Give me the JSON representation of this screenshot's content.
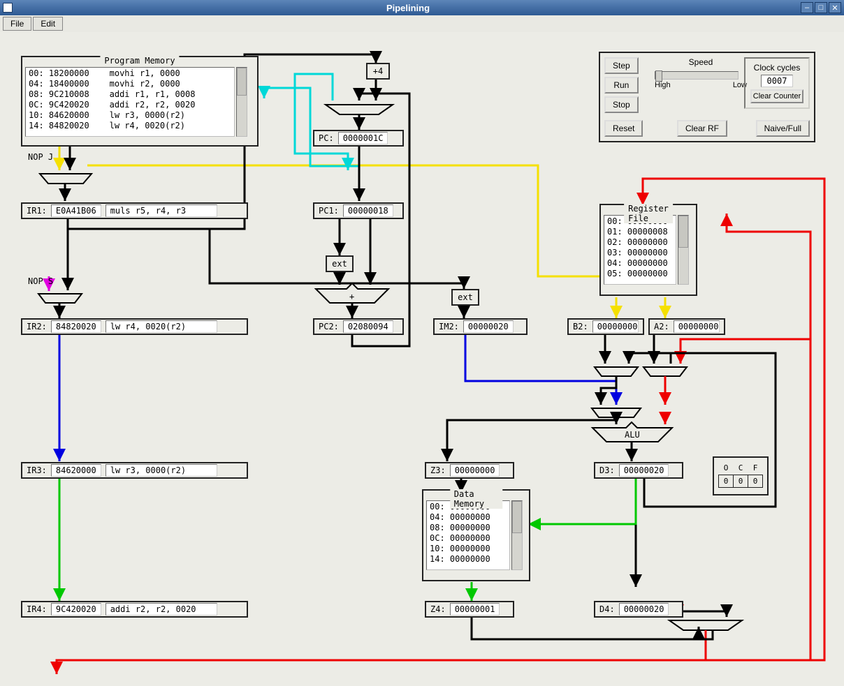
{
  "window": {
    "title": "Pipelining"
  },
  "menu": {
    "file": "File",
    "edit": "Edit"
  },
  "program_memory": {
    "caption": "Program Memory",
    "rows": [
      {
        "addr": "00:",
        "hex": "18200000",
        "asm": "movhi r1, 0000"
      },
      {
        "addr": "04:",
        "hex": "18400000",
        "asm": "movhi r2, 0000"
      },
      {
        "addr": "08:",
        "hex": "9C210008",
        "asm": "addi r1, r1, 0008"
      },
      {
        "addr": "0C:",
        "hex": "9C420020",
        "asm": "addi r2, r2, 0020"
      },
      {
        "addr": "10:",
        "hex": "84620000",
        "asm": "lw r3, 0000(r2)"
      },
      {
        "addr": "14:",
        "hex": "84820020",
        "asm": "lw r4, 0020(r2)"
      }
    ]
  },
  "nop_j": "NOP J",
  "nop_s": "NOP S",
  "plus4_label": "+4",
  "pc": {
    "label": "PC:",
    "value": "0000001C"
  },
  "pc1": {
    "label": "PC1:",
    "value": "00000018"
  },
  "ext1_label": "ext",
  "plus_label": "+",
  "pc2": {
    "label": "PC2:",
    "value": "02080094"
  },
  "ext2_label": "ext",
  "ir1": {
    "label": "IR1:",
    "hex": "E0A41B06",
    "asm": "muls r5, r4, r3"
  },
  "ir2": {
    "label": "IR2:",
    "hex": "84820020",
    "asm": "lw r4, 0020(r2)"
  },
  "ir3": {
    "label": "IR3:",
    "hex": "84620000",
    "asm": "lw r3, 0000(r2)"
  },
  "ir4": {
    "label": "IR4:",
    "hex": "9C420020",
    "asm": "addi r2, r2, 0020"
  },
  "im2": {
    "label": "IM2:",
    "value": "00000020"
  },
  "b2": {
    "label": "B2:",
    "value": "00000000"
  },
  "a2": {
    "label": "A2:",
    "value": "00000000"
  },
  "z3": {
    "label": "Z3:",
    "value": "00000000"
  },
  "d3": {
    "label": "D3:",
    "value": "00000020"
  },
  "z4": {
    "label": "Z4:",
    "value": "00000001"
  },
  "d4": {
    "label": "D4:",
    "value": "00000020"
  },
  "alu_label": "ALU",
  "register_file": {
    "caption": "Register File",
    "rows": [
      {
        "addr": "00:",
        "val": "00000000"
      },
      {
        "addr": "01:",
        "val": "00000008"
      },
      {
        "addr": "02:",
        "val": "00000000"
      },
      {
        "addr": "03:",
        "val": "00000000"
      },
      {
        "addr": "04:",
        "val": "00000000"
      },
      {
        "addr": "05:",
        "val": "00000000"
      }
    ]
  },
  "data_memory": {
    "caption": "Data Memory",
    "rows": [
      {
        "addr": "00:",
        "val": "00000000"
      },
      {
        "addr": "04:",
        "val": "00000000"
      },
      {
        "addr": "08:",
        "val": "00000000"
      },
      {
        "addr": "0C:",
        "val": "00000000"
      },
      {
        "addr": "10:",
        "val": "00000000"
      },
      {
        "addr": "14:",
        "val": "00000000"
      }
    ]
  },
  "ocf": {
    "h_o": "O",
    "h_c": "C",
    "h_f": "F",
    "v_o": "0",
    "v_c": "0",
    "v_f": "0"
  },
  "controls": {
    "step": "Step",
    "run": "Run",
    "stop": "Stop",
    "reset": "Reset",
    "speed_label": "Speed",
    "high": "High",
    "low": "Low",
    "clear_rf": "Clear RF",
    "clock_label": "Clock cycles",
    "clock_value": "0007",
    "clear_counter": "Clear Counter",
    "naive_full": "Naive/Full"
  }
}
